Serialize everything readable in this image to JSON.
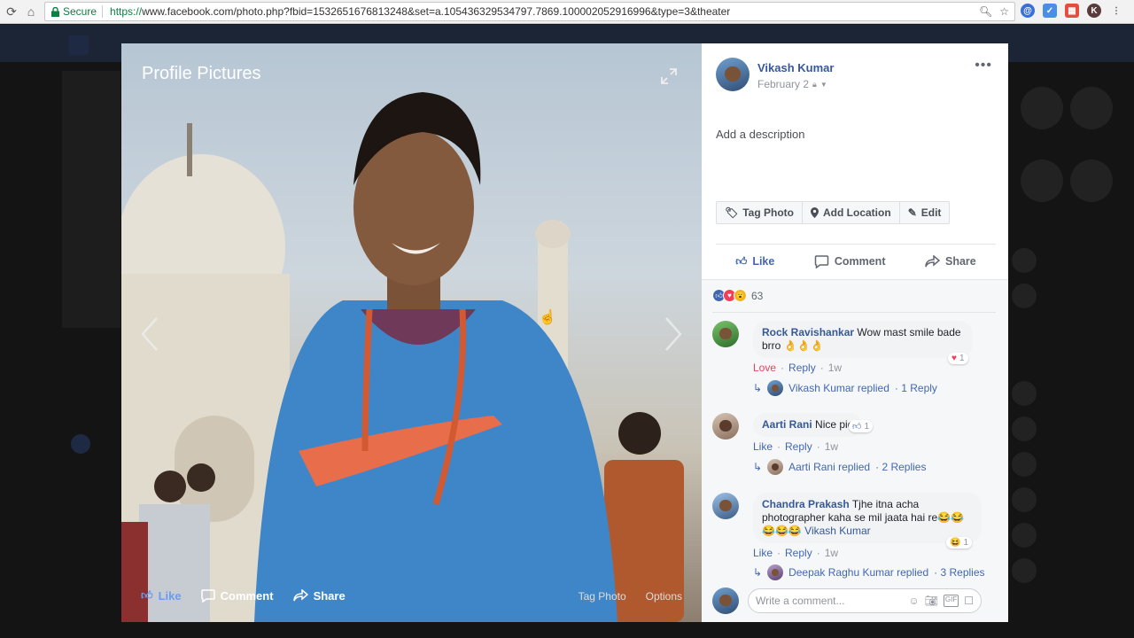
{
  "browser": {
    "secure_label": "Secure",
    "url_scheme": "https://",
    "url_rest": "www.facebook.com/photo.php?fbid=1532651676813248&set=a.105436329534797.7869.100002052916996&type=3&theater"
  },
  "photo": {
    "album_title": "Profile Pictures",
    "actions": {
      "like": "Like",
      "comment": "Comment",
      "share": "Share"
    },
    "right_actions": {
      "tag_photo": "Tag Photo",
      "options": "Options"
    }
  },
  "post": {
    "author": "Vikash Kumar",
    "date": "February 2",
    "add_description": "Add a description",
    "tag_buttons": {
      "tag_photo": "Tag Photo",
      "add_location": "Add Location",
      "edit": "Edit"
    },
    "actions": {
      "like": "Like",
      "comment": "Comment",
      "share": "Share"
    },
    "reaction_count": "63"
  },
  "comments": [
    {
      "name": "Rock Ravishankar",
      "text": "Wow mast smile bade",
      "text2": "brro 👌👌👌",
      "meta": {
        "reaction": "Love",
        "reply": "Reply",
        "time": "1w"
      },
      "badge_count": "1",
      "reply_author": "Vikash Kumar replied",
      "reply_count": "· 1 Reply"
    },
    {
      "name": "Aarti Rani",
      "text": "Nice pic",
      "meta": {
        "reaction": "Like",
        "reply": "Reply",
        "time": "1w"
      },
      "badge_count": "1",
      "reply_author": "Aarti Rani replied",
      "reply_count": "· 2 Replies"
    },
    {
      "name": "Chandra Prakash",
      "text": "Tjhe itna acha",
      "text2": "photographer kaha se mil jaata hai re😂😂",
      "text3": "😂😂😂",
      "mention": "Vikash Kumar",
      "meta": {
        "reaction": "Like",
        "reply": "Reply",
        "time": "1w"
      },
      "badge_count": "1",
      "reply_author": "Deepak Raghu Kumar replied",
      "reply_count": "· 3 Replies"
    }
  ],
  "write_comment": {
    "placeholder": "Write a comment..."
  },
  "colors": {
    "link": "#365899",
    "like_blue": "#4267b2",
    "love_red": "#f33e58"
  }
}
